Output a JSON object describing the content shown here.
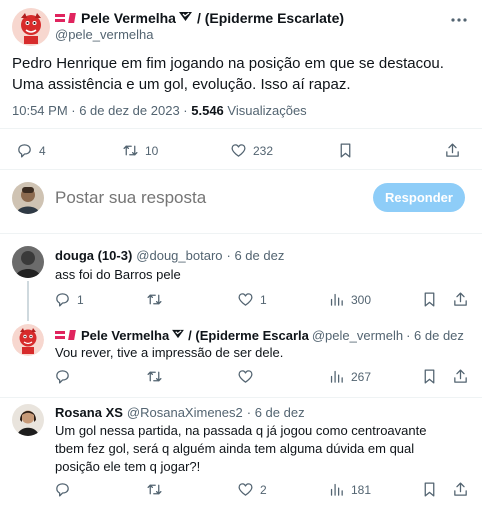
{
  "main_tweet": {
    "display_name": "Pele Vermelha",
    "display_suffix": "/ (Epiderme Escarlate)",
    "handle": "@pele_vermelha",
    "text": "Pedro Henrique em fim jogando na posição em que se destacou. Uma assistência e um gol, evolução. Isso aí rapaz.",
    "time": "10:54 PM · 6 de dez de 2023 ·",
    "views_count": "5.546",
    "views_label": "Visualizações",
    "replies": "4",
    "retweets": "10",
    "likes": "232",
    "more_icon": "ellipsis-icon"
  },
  "composer": {
    "placeholder": "Postar sua resposta",
    "button_label": "Responder",
    "button_color": "#8ecdf8"
  },
  "replies": [
    {
      "name": "douga (10-3)",
      "handle": "@doug_botaro",
      "date": "· 6 de dez",
      "text": "ass foi do Barros pele",
      "replies": "1",
      "retweets": "",
      "likes": "1",
      "views": "300"
    },
    {
      "name": "Pele Vermelha",
      "name_suffix": "/ (Epiderme Escarla",
      "handle": "@pele_vermelh",
      "date": "· 6 de dez",
      "text": "Vou rever, tive a impressão de ser dele.",
      "replies": "",
      "retweets": "",
      "likes": "",
      "views": "267"
    },
    {
      "name": "Rosana XS",
      "handle": "@RosanaXimenes2",
      "date": "· 6 de dez",
      "text": "Um gol nessa partida, na passada q já jogou como centroavante tbem fez gol, será q alguém ainda tem alguma dúvida em qual posição ele tem q jogar?!",
      "replies": "",
      "retweets": "",
      "likes": "2",
      "views": "181"
    }
  ],
  "colors": {
    "accent": "#e0245e",
    "muted": "#536471",
    "reply_button": "#8ecdf8"
  }
}
